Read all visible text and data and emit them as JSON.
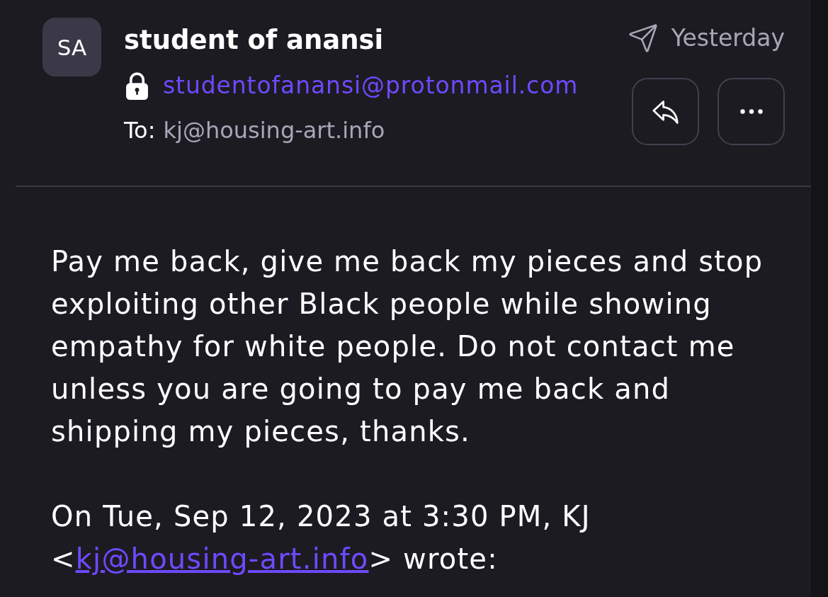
{
  "message": {
    "sender": {
      "avatar_initials": "SA",
      "name": "student of anansi",
      "email": "studentofanansi@protonmail.com",
      "to_label": "To:",
      "to_address": "kj@housing-art.info"
    },
    "date": "Yesterday",
    "body": {
      "paragraphs": [
        "Pay me back, give me back my pieces and stop exploiting other Black people while showing empathy for white people. Do not contact me unless you are going to pay me back and shipping my pieces, thanks."
      ],
      "quote_header": {
        "text_before": "On Tue, Sep 12, 2023 at 3:30 PM, KJ <",
        "link": "kj@housing-art.info",
        "text_after": "> wrote:"
      }
    }
  }
}
